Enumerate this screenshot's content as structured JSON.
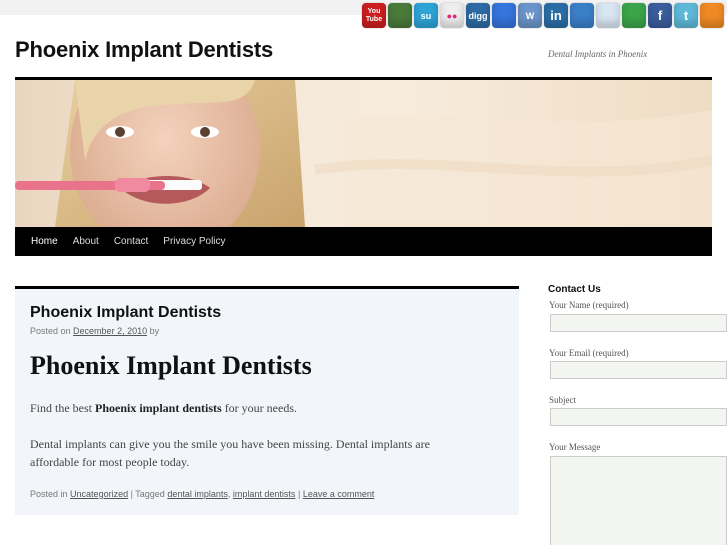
{
  "social_icons": [
    {
      "name": "youtube-icon",
      "label": "You Tube",
      "color": "#cc1f1f"
    },
    {
      "name": "plant-icon",
      "label": "",
      "color": "#4a7a3a"
    },
    {
      "name": "stumbleupon-icon",
      "label": "su",
      "color": "#2ea3d6"
    },
    {
      "name": "flickr-icon",
      "label": "●●",
      "color": "#eeeeee"
    },
    {
      "name": "digg-icon",
      "label": "digg",
      "color": "#2d6aa3"
    },
    {
      "name": "delicious-icon",
      "label": "",
      "color": "#3574dc"
    },
    {
      "name": "wordpress-icon",
      "label": "W",
      "color": "#6b94c9"
    },
    {
      "name": "linkedin-icon",
      "label": "in",
      "color": "#2b6ea6"
    },
    {
      "name": "myspace-icon",
      "label": "",
      "color": "#3a7fc8"
    },
    {
      "name": "reddit-icon",
      "label": "",
      "color": "#d8e6f2"
    },
    {
      "name": "technorati-icon",
      "label": "",
      "color": "#3aa54a"
    },
    {
      "name": "facebook-icon",
      "label": "f",
      "color": "#3b5c9c"
    },
    {
      "name": "twitter-icon",
      "label": "t",
      "color": "#5fb8d8"
    },
    {
      "name": "rss-icon",
      "label": "",
      "color": "#f08a24"
    }
  ],
  "site": {
    "title": "Phoenix Implant Dentists",
    "description": "Dental Implants in Phoenix"
  },
  "nav": [
    "Home",
    "About",
    "Contact",
    "Privacy Policy"
  ],
  "post": {
    "title": "Phoenix Implant Dentists",
    "meta_prefix": "Posted on",
    "meta_date": "December 2, 2010",
    "meta_suffix": "by",
    "heading": "Phoenix Implant Dentists",
    "p1_before": "Find the best",
    "p1_bold": "Phoenix implant dentists",
    "p1_after": "for your needs.",
    "p2": "Dental implants can give you the smile you have been missing. Dental implants are affordable for most people today.",
    "footer": {
      "posted_in": "Posted in",
      "category": "Uncategorized",
      "tagged": "| Tagged",
      "tag1": "dental implants",
      "comma": ",",
      "tag2": "implant dentists",
      "sep": "|",
      "comment": "Leave a comment"
    }
  },
  "sidebar": {
    "title": "Contact Us",
    "name_label": "Your Name (required)",
    "email_label": "Your Email (required)",
    "subject_label": "Subject",
    "message_label": "Your Message"
  }
}
